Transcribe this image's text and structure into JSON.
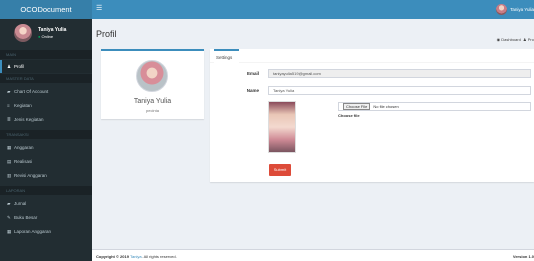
{
  "app": {
    "brand": "OCODocument",
    "toggle_icon": "☰",
    "user_name_short": "Taniya Yulia"
  },
  "sidebar": {
    "user_name": "Taniya Yulia",
    "status": "Online",
    "section_main": "MAIN",
    "item_profil": "Profil",
    "section_master": "MASTER DATA",
    "item_chart_of_account": "Chart Of Account",
    "item_kegiatan": "Kegiatan",
    "item_jenis_kegiatan": "Jenis Kegiatan",
    "section_transaksi": "TRANSAKSI",
    "item_anggaran": "Anggaran",
    "item_realisasi": "Realisasi",
    "item_revisi_anggaran": "Revisi Anggaran",
    "section_laporan": "LAPORAN",
    "item_jurnal": "Jurnal",
    "item_buku_besar": "Buku Besar",
    "item_laporan_anggaran": "Laporan Anggaran"
  },
  "header": {
    "title": "Profil",
    "breadcrumb_dashboard": "Dashboard",
    "breadcrumb_current": "Pro"
  },
  "profile": {
    "name": "Taniya Yulia",
    "role": "pecinta"
  },
  "settings": {
    "tab_label": "Settings",
    "email_label": "Email",
    "email_value": "taniyayulia519@gmail.com",
    "name_label": "Name",
    "name_value": "Taniya Yulia",
    "file_button": "Choose File",
    "file_status": "No file chosen",
    "file_note": "Choose file",
    "submit_label": "Submit"
  },
  "footer": {
    "copyright_prefix": "Copyright © 2019",
    "copyright_link": "Taniya",
    "copyright_suffix": ". All rights reserved.",
    "version": "Version 1.0"
  },
  "colors": {
    "topbar": "#3c8dbc",
    "brand_bg": "#367fa9",
    "sidebar": "#222d32",
    "accent": "#3c8dbc",
    "danger": "#dd4b39",
    "page_bg": "#ecf0f5"
  },
  "icons": {
    "user": "user-icon",
    "book": "book-icon",
    "list": "list-icon",
    "table": "table-icon",
    "money": "money-icon",
    "dashboard": "dashboard-icon"
  }
}
